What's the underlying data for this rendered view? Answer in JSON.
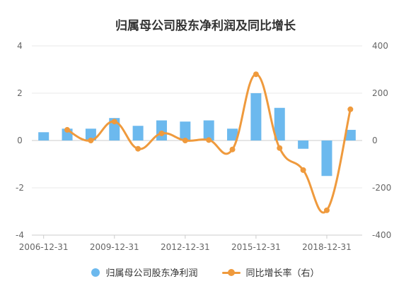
{
  "colors": {
    "bar": "#6cb9ee",
    "line": "#ef9a3d",
    "grid": "#e8e8e8",
    "axis": "#cccccc"
  },
  "chart_data": {
    "type": "bar",
    "title": "归属母公司股东净利润及同比增长",
    "x_tick_labels": [
      "2006-12-31",
      "2009-12-31",
      "2012-12-31",
      "2015-12-31",
      "2018-12-31"
    ],
    "left_axis": {
      "ylim": [
        -4,
        4
      ],
      "ticks": [
        4,
        2,
        0,
        -2,
        -4
      ]
    },
    "right_axis": {
      "ylim": [
        -400,
        400
      ],
      "ticks": [
        400,
        200,
        0,
        -200,
        -400
      ]
    },
    "categories": [
      "2006-12-31",
      "2007-12-31",
      "2008-12-31",
      "2009-12-31",
      "2010-12-31",
      "2011-12-31",
      "2012-12-31",
      "2013-12-31",
      "2014-12-31",
      "2015-12-31",
      "2016-12-31",
      "2017-12-31",
      "2018-12-31",
      "2019-12-31"
    ],
    "series": [
      {
        "name": "归属母公司股东净利润",
        "type": "bar",
        "axis": "left",
        "values": [
          0.35,
          0.5,
          0.5,
          0.95,
          0.62,
          0.85,
          0.8,
          0.85,
          0.5,
          2.0,
          1.38,
          -0.35,
          -1.5,
          0.45
        ]
      },
      {
        "name": "同比增长率（右）",
        "type": "line",
        "axis": "right",
        "values": [
          null,
          45,
          0,
          80,
          -35,
          30,
          0,
          2,
          -38,
          280,
          -32,
          -125,
          -295,
          132
        ]
      }
    ],
    "legend_position": "bottom",
    "grid": true
  }
}
